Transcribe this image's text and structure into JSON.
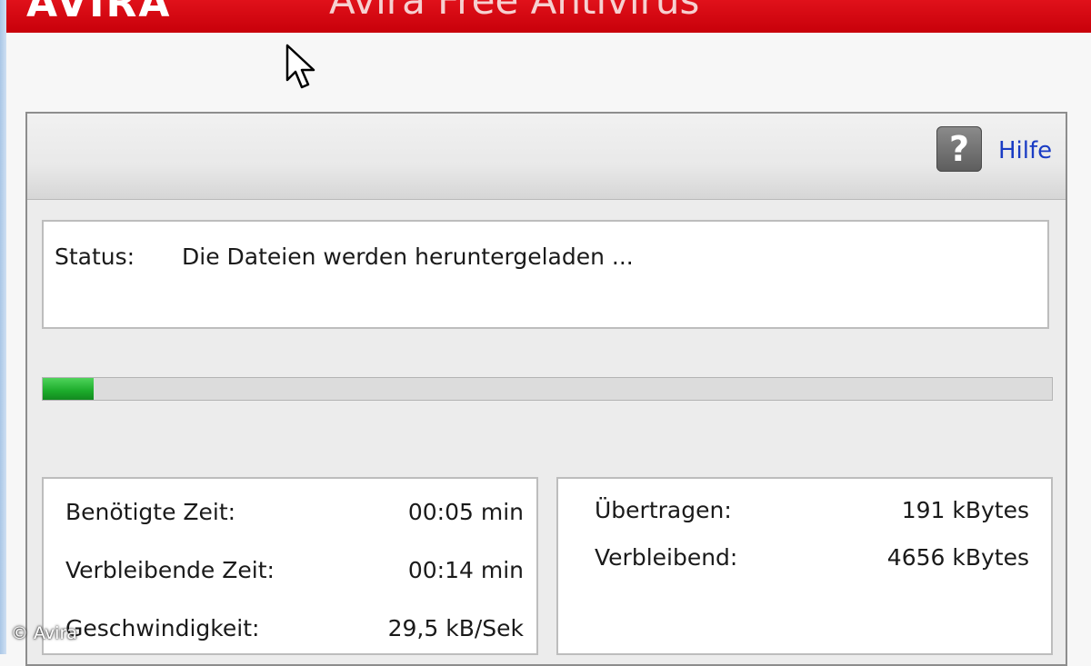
{
  "window": {
    "logo_text": "AVIRA",
    "product_title": "Avira Free Antivirus"
  },
  "toolbar": {
    "help_icon_glyph": "?",
    "help_label": "Hilfe"
  },
  "status": {
    "label": "Status:",
    "text": "Die Dateien werden heruntergeladen ..."
  },
  "progress": {
    "percent": 5,
    "color": "#1cab2b"
  },
  "stats_left": [
    {
      "label": "Benötigte Zeit:",
      "value": "00:05 min"
    },
    {
      "label": "Verbleibende Zeit:",
      "value": "00:14 min"
    },
    {
      "label": "Geschwindigkeit:",
      "value": "29,5 kB/Sek"
    }
  ],
  "stats_right": [
    {
      "label": "Übertragen:",
      "value": "191 kBytes"
    },
    {
      "label": "Verbleibend:",
      "value": "4656 kBytes"
    }
  ],
  "watermark": "© Avira",
  "colors": {
    "titlebar": "#d0000c",
    "link": "#1a3cc4"
  }
}
